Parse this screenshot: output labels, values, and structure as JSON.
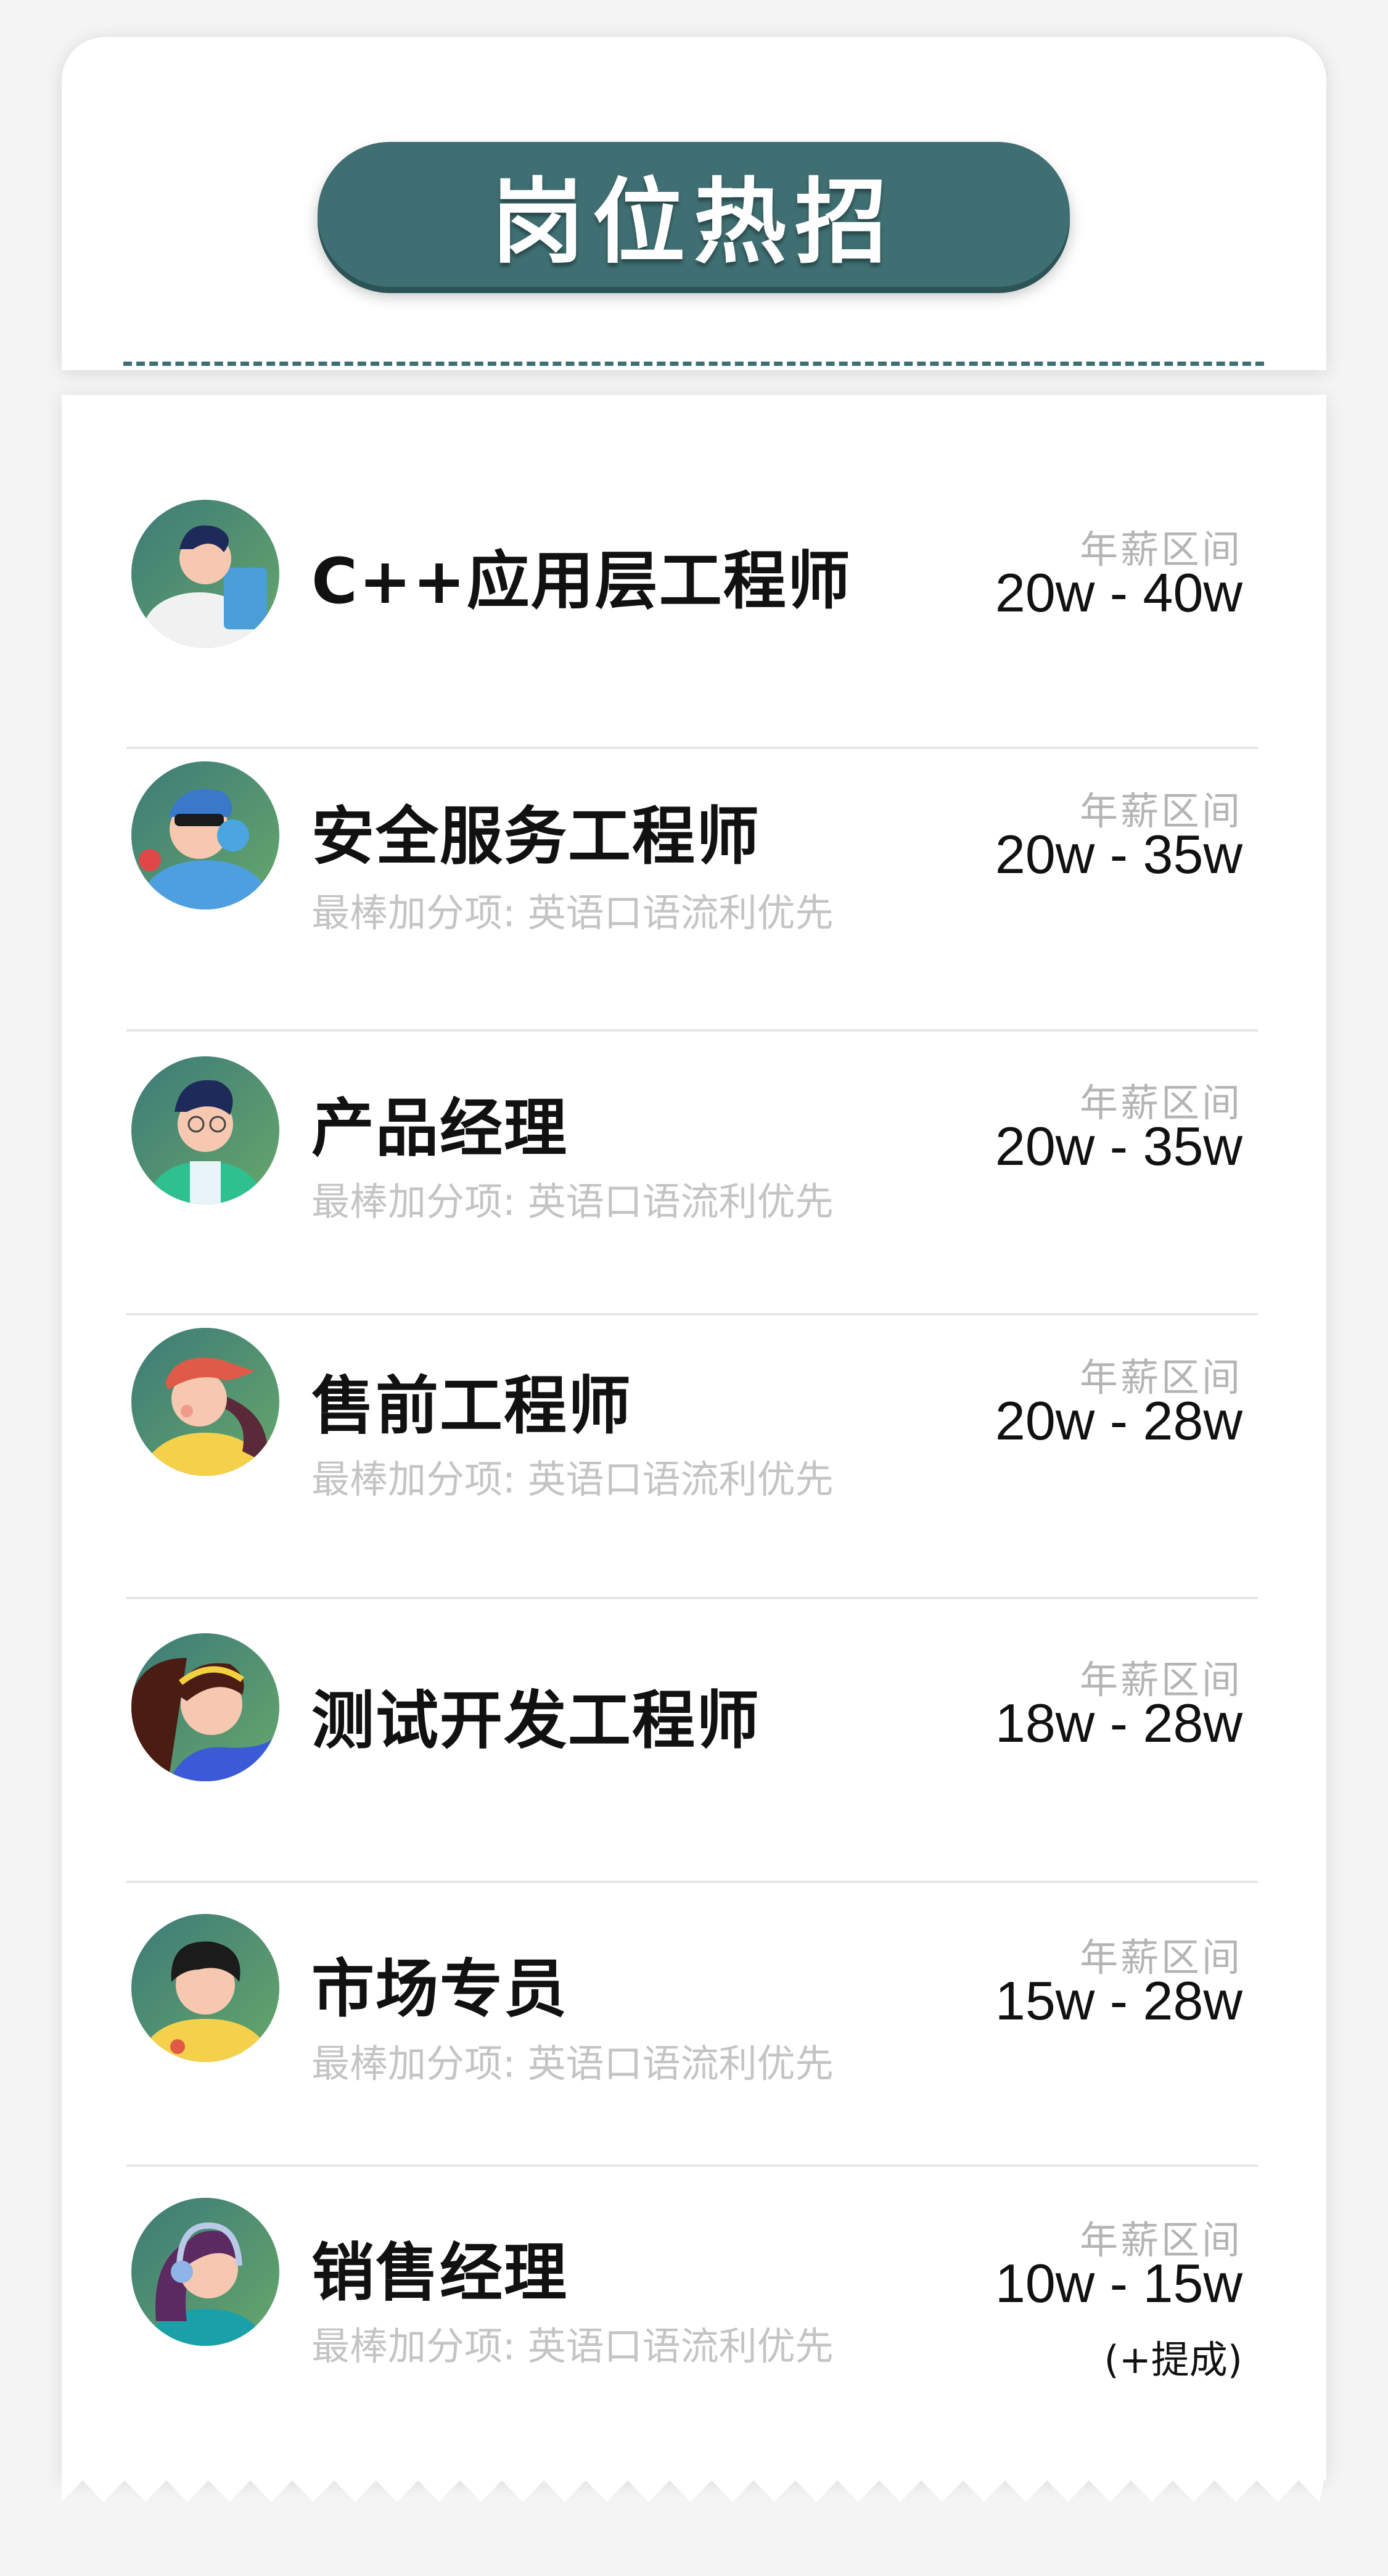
{
  "header": {
    "title": "岗位热招"
  },
  "salary_label": "年薪区间",
  "bonus_text": "最棒加分项: 英语口语流利优先",
  "colors": {
    "title_pill": "#3f6f72",
    "dash": "#3e6f75",
    "avatar_bg_top": "#3d7a78",
    "avatar_bg_bottom": "#66a86a"
  },
  "jobs": [
    {
      "title": "C++应用层工程师",
      "salary": "20w - 40w",
      "bonus": "",
      "note": "",
      "avatar_icon": "boy-with-tablet-avatar"
    },
    {
      "title": "安全服务工程师",
      "salary": "20w - 35w",
      "bonus": "最棒加分项: 英语口语流利优先",
      "note": "",
      "avatar_icon": "girl-with-headphones-avatar"
    },
    {
      "title": "产品经理",
      "salary": "20w - 35w",
      "bonus": "最棒加分项: 英语口语流利优先",
      "note": "",
      "avatar_icon": "man-with-glasses-avatar"
    },
    {
      "title": "售前工程师",
      "salary": "20w - 28w",
      "bonus": "最棒加分项: 英语口语流利优先",
      "note": "",
      "avatar_icon": "girl-with-cap-avatar"
    },
    {
      "title": "测试开发工程师",
      "salary": "18w - 28w",
      "bonus": "",
      "note": "",
      "avatar_icon": "girl-with-headband-avatar"
    },
    {
      "title": "市场专员",
      "salary": "15w - 28w",
      "bonus": "最棒加分项: 英语口语流利优先",
      "note": "",
      "avatar_icon": "boy-in-yellow-avatar"
    },
    {
      "title": "销售经理",
      "salary": "10w - 15w",
      "bonus": "最棒加分项: 英语口语流利优先",
      "note": "(+提成)",
      "avatar_icon": "girl-with-earphones-avatar"
    }
  ]
}
